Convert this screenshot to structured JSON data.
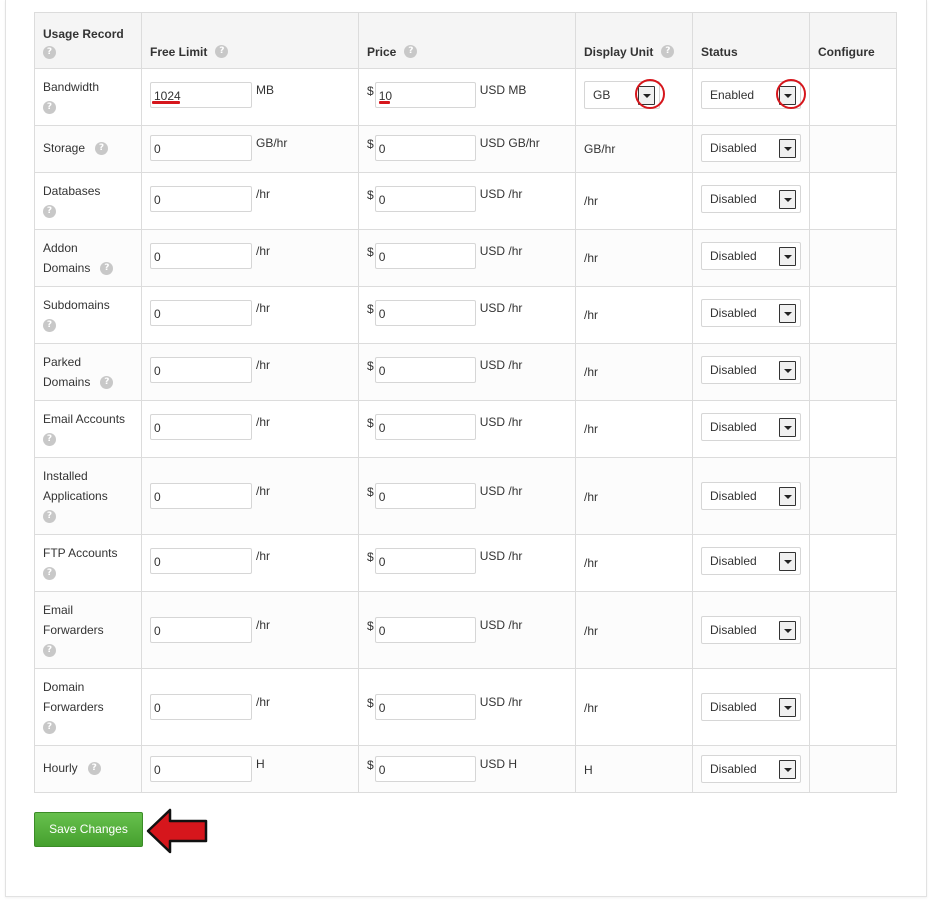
{
  "colors": {
    "accent_red": "#d6161c",
    "save_green": "#4caf35"
  },
  "table": {
    "headers": {
      "usage_record": "Usage Record",
      "free_limit": "Free Limit",
      "price": "Price",
      "display_unit": "Display Unit",
      "status": "Status",
      "configure": "Configure"
    },
    "help_glyph": "?",
    "currency_symbol": "$",
    "rows": [
      {
        "label_line1": "Bandwidth",
        "label_line2": "",
        "free_limit": "1024",
        "free_unit": "MB",
        "price": "10",
        "price_unit": "USD MB",
        "display_unit": "GB",
        "status": "Enabled"
      },
      {
        "label_line1": "Storage",
        "label_line2": "",
        "free_limit": "0",
        "free_unit": "GB/hr",
        "price": "0",
        "price_unit": "USD GB/hr",
        "display_unit": "GB/hr",
        "status": "Disabled"
      },
      {
        "label_line1": "Databases",
        "label_line2": "",
        "free_limit": "0",
        "free_unit": "/hr",
        "price": "0",
        "price_unit": "USD /hr",
        "display_unit": "/hr",
        "status": "Disabled"
      },
      {
        "label_line1": "Addon",
        "label_line2": "Domains",
        "free_limit": "0",
        "free_unit": "/hr",
        "price": "0",
        "price_unit": "USD /hr",
        "display_unit": "/hr",
        "status": "Disabled"
      },
      {
        "label_line1": "Subdomains",
        "label_line2": "",
        "free_limit": "0",
        "free_unit": "/hr",
        "price": "0",
        "price_unit": "USD /hr",
        "display_unit": "/hr",
        "status": "Disabled"
      },
      {
        "label_line1": "Parked",
        "label_line2": "Domains",
        "free_limit": "0",
        "free_unit": "/hr",
        "price": "0",
        "price_unit": "USD /hr",
        "display_unit": "/hr",
        "status": "Disabled"
      },
      {
        "label_line1": "Email Accounts",
        "label_line2": "",
        "free_limit": "0",
        "free_unit": "/hr",
        "price": "0",
        "price_unit": "USD /hr",
        "display_unit": "/hr",
        "status": "Disabled"
      },
      {
        "label_line1": "Installed",
        "label_line2": "Applications",
        "free_limit": "0",
        "free_unit": "/hr",
        "price": "0",
        "price_unit": "USD /hr",
        "display_unit": "/hr",
        "status": "Disabled"
      },
      {
        "label_line1": "FTP Accounts",
        "label_line2": "",
        "free_limit": "0",
        "free_unit": "/hr",
        "price": "0",
        "price_unit": "USD /hr",
        "display_unit": "/hr",
        "status": "Disabled"
      },
      {
        "label_line1": "Email",
        "label_line2": "Forwarders",
        "free_limit": "0",
        "free_unit": "/hr",
        "price": "0",
        "price_unit": "USD /hr",
        "display_unit": "/hr",
        "status": "Disabled"
      },
      {
        "label_line1": "Domain",
        "label_line2": "Forwarders",
        "free_limit": "0",
        "free_unit": "/hr",
        "price": "0",
        "price_unit": "USD /hr",
        "display_unit": "/hr",
        "status": "Disabled"
      },
      {
        "label_line1": "Hourly",
        "label_line2": "",
        "free_limit": "0",
        "free_unit": "H",
        "price": "0",
        "price_unit": "USD H",
        "display_unit": "H",
        "status": "Disabled"
      }
    ]
  },
  "save_button": {
    "label": "Save Changes"
  },
  "annotation": {
    "pointer_icon": "red-left-arrow-icon",
    "highlight_icon": "red-circle-icon"
  }
}
